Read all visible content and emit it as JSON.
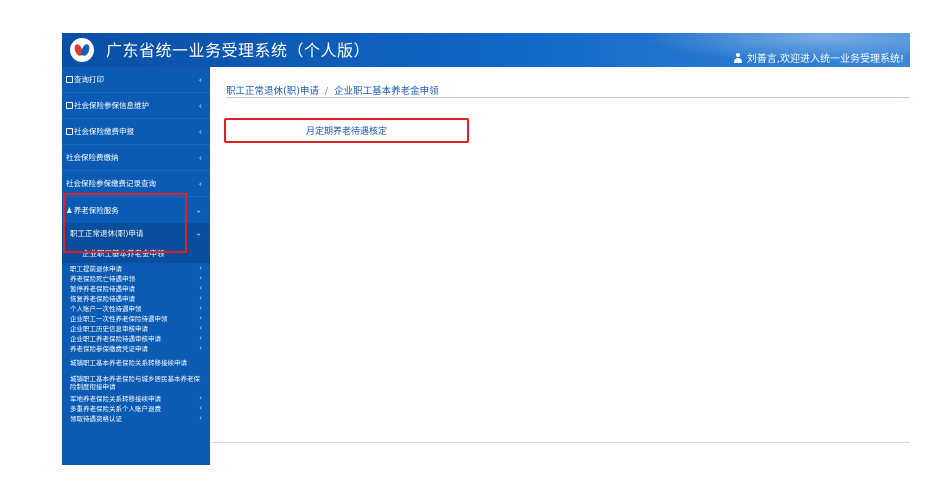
{
  "header": {
    "title": "广东省统一业务受理系统（个人版）",
    "welcome": "刘善言,欢迎进入统一业务受理系统!"
  },
  "sidebar": {
    "top_items": [
      {
        "label": "查询打印"
      },
      {
        "label": "社会保险参保信息维护"
      },
      {
        "label": "社会保险缴费申报"
      },
      {
        "label": "社会保险费缴纳"
      },
      {
        "label": "社会保险参保缴费记录查询"
      }
    ],
    "expanded": {
      "label": "养老保险服务",
      "sub_label": "职工正常退休(职)申请",
      "sub_sub_label": "企业职工基本养老金申领"
    },
    "small_items": [
      {
        "label": "职工提前退休申请"
      },
      {
        "label": "养老保险死亡待遇申领"
      },
      {
        "label": "暂停养老保险待遇申请"
      },
      {
        "label": "恢复养老保险待遇申请"
      },
      {
        "label": "个人账户一次性待遇申领"
      },
      {
        "label": "企业职工一次性养老保险待遇申领"
      },
      {
        "label": "企业职工历史信息审核申请"
      },
      {
        "label": "企业职工养老保险待遇审核申请"
      },
      {
        "label": "养老保险参保缴费凭证申请"
      }
    ],
    "tall_items": [
      {
        "label": "城镇职工基本养老保险关系转移接续申请"
      },
      {
        "label": "城镇职工基本养老保险与城乡居民基本养老保险制度衔接申请"
      }
    ],
    "bottom_items": [
      {
        "label": "军地养老保险关系转移接续申请"
      },
      {
        "label": "多重养老保险关系个人账户退费"
      },
      {
        "label": "领取待遇资格认证"
      }
    ]
  },
  "content": {
    "breadcrumb": [
      "职工正常退休(职)申请",
      "企业职工基本养老金申领"
    ],
    "breadcrumb_separator": "/",
    "tile_label": "月定期养老待遇核定"
  }
}
